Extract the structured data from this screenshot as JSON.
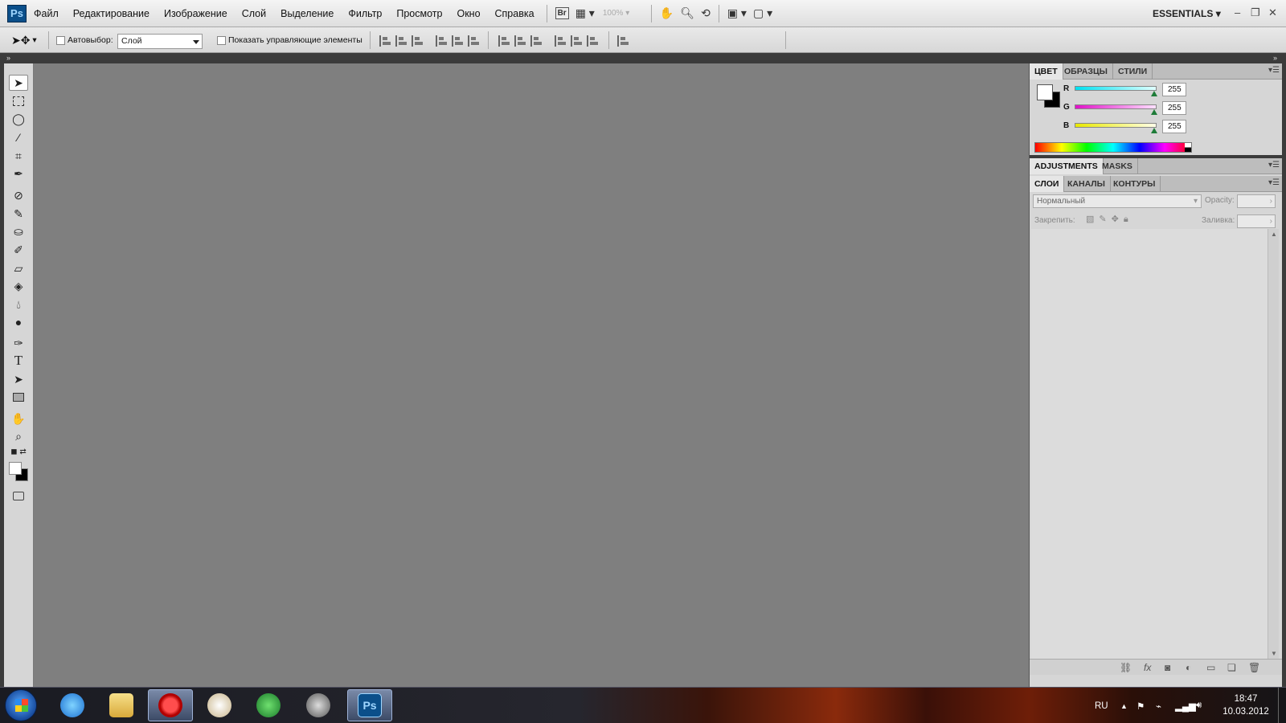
{
  "app": {
    "logo": "Ps",
    "workspace": "ESSENTIALS"
  },
  "menu": [
    "Файл",
    "Редактирование",
    "Изображение",
    "Слой",
    "Выделение",
    "Фильтр",
    "Просмотр",
    "Окно",
    "Справка"
  ],
  "menubar_tools": {
    "bridge_label": "Br",
    "zoom_value": "100%"
  },
  "options": {
    "auto_select_label": "Автовыбор:",
    "auto_select_value": "Слой",
    "show_controls_label": "Показать управляющие элементы"
  },
  "color_panel": {
    "tabs": [
      "ЦВЕТ",
      "ОБРАЗЦЫ",
      "СТИЛИ"
    ],
    "channels": [
      {
        "label": "R",
        "value": "255",
        "color": "#00d7e8"
      },
      {
        "label": "G",
        "value": "255",
        "color": "#e820d0"
      },
      {
        "label": "B",
        "value": "255",
        "color": "#e8e800"
      }
    ],
    "foreground": "#ffffff",
    "background": "#000000"
  },
  "adjustments_panel": {
    "tabs": [
      "ADJUSTMENTS",
      "MASKS"
    ]
  },
  "layers_panel": {
    "tabs": [
      "СЛОИ",
      "КАНАЛЫ",
      "КОНТУРЫ"
    ],
    "blend_mode": "Нормальный",
    "opacity_label": "Opacity:",
    "lock_label": "Закрепить:",
    "fill_label": "Заливка:"
  },
  "taskbar": {
    "language": "RU",
    "time": "18:47",
    "date": "10.03.2012"
  }
}
